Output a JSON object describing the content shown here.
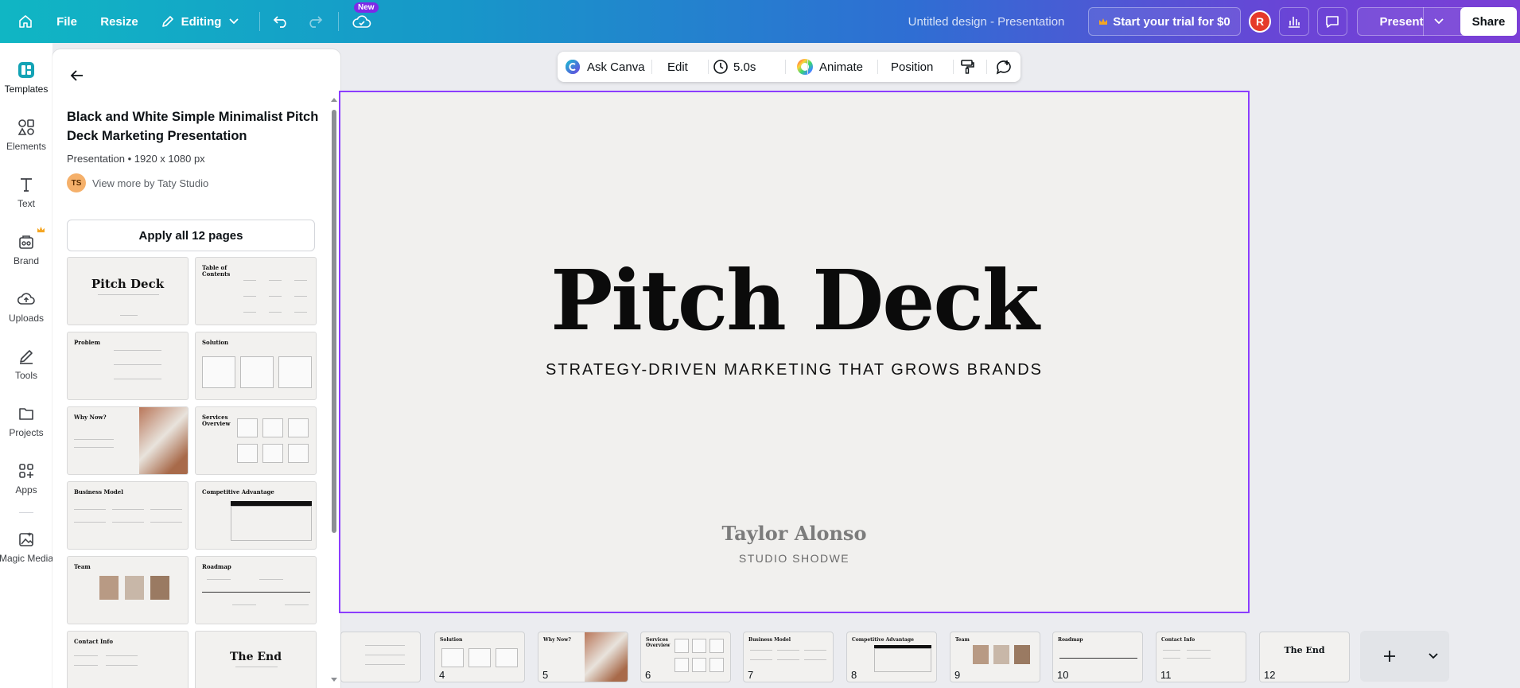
{
  "topbar": {
    "home_icon": "home-icon",
    "file_label": "File",
    "resize_label": "Resize",
    "editing_label": "Editing",
    "new_badge": "New",
    "document_title": "Untitled design - Presentation",
    "trial_label": "Start your trial for $0",
    "avatar_initial": "R",
    "present_label": "Present",
    "share_label": "Share"
  },
  "rail": {
    "items": [
      {
        "label": "Templates",
        "icon": "templates-icon"
      },
      {
        "label": "Elements",
        "icon": "elements-icon"
      },
      {
        "label": "Text",
        "icon": "text-icon"
      },
      {
        "label": "Brand",
        "icon": "brand-icon"
      },
      {
        "label": "Uploads",
        "icon": "uploads-icon"
      },
      {
        "label": "Tools",
        "icon": "tools-icon"
      },
      {
        "label": "Projects",
        "icon": "projects-icon"
      },
      {
        "label": "Apps",
        "icon": "apps-icon"
      },
      {
        "label": "Magic Media",
        "icon": "magic-media-icon"
      }
    ]
  },
  "panel": {
    "title": "Black and White Simple Minimalist Pitch Deck Marketing Presentation",
    "meta": "Presentation • 1920 x 1080 px",
    "author_initials": "TS",
    "author_link": "View more by Taty Studio",
    "apply_label": "Apply all 12 pages",
    "thumbnails": [
      {
        "title": "Pitch Deck"
      },
      {
        "title": "Table of Contents"
      },
      {
        "title": "Problem"
      },
      {
        "title": "Solution"
      },
      {
        "title": "Why Now?"
      },
      {
        "title": "Services Overview"
      },
      {
        "title": "Business Model"
      },
      {
        "title": "Competitive Advantage"
      },
      {
        "title": "Team"
      },
      {
        "title": "Roadmap"
      },
      {
        "title": "Contact Info"
      },
      {
        "title": "The End"
      }
    ]
  },
  "context_toolbar": {
    "ask_canva": "Ask Canva",
    "edit": "Edit",
    "duration": "5.0s",
    "animate": "Animate",
    "position": "Position"
  },
  "slide": {
    "title": "Pitch Deck",
    "subtitle": "STRATEGY-DRIVEN MARKETING THAT GROWS BRANDS",
    "name": "Taylor Alonso",
    "studio": "STUDIO SHODWE",
    "selection_color": "#8b3dff"
  },
  "filmstrip": {
    "pages": [
      {
        "number": "",
        "title": ""
      },
      {
        "number": "4",
        "title": "Solution"
      },
      {
        "number": "5",
        "title": "Why Now?"
      },
      {
        "number": "6",
        "title": "Services Overview"
      },
      {
        "number": "7",
        "title": "Business Model"
      },
      {
        "number": "8",
        "title": "Competitive Advantage"
      },
      {
        "number": "9",
        "title": "Team"
      },
      {
        "number": "10",
        "title": "Roadmap"
      },
      {
        "number": "11",
        "title": "Contact Info"
      },
      {
        "number": "12",
        "title": "The End"
      }
    ]
  },
  "colors": {
    "accent": "#8b3dff",
    "new_badge": "#7d2ae8",
    "avatar": "#e5392a"
  }
}
